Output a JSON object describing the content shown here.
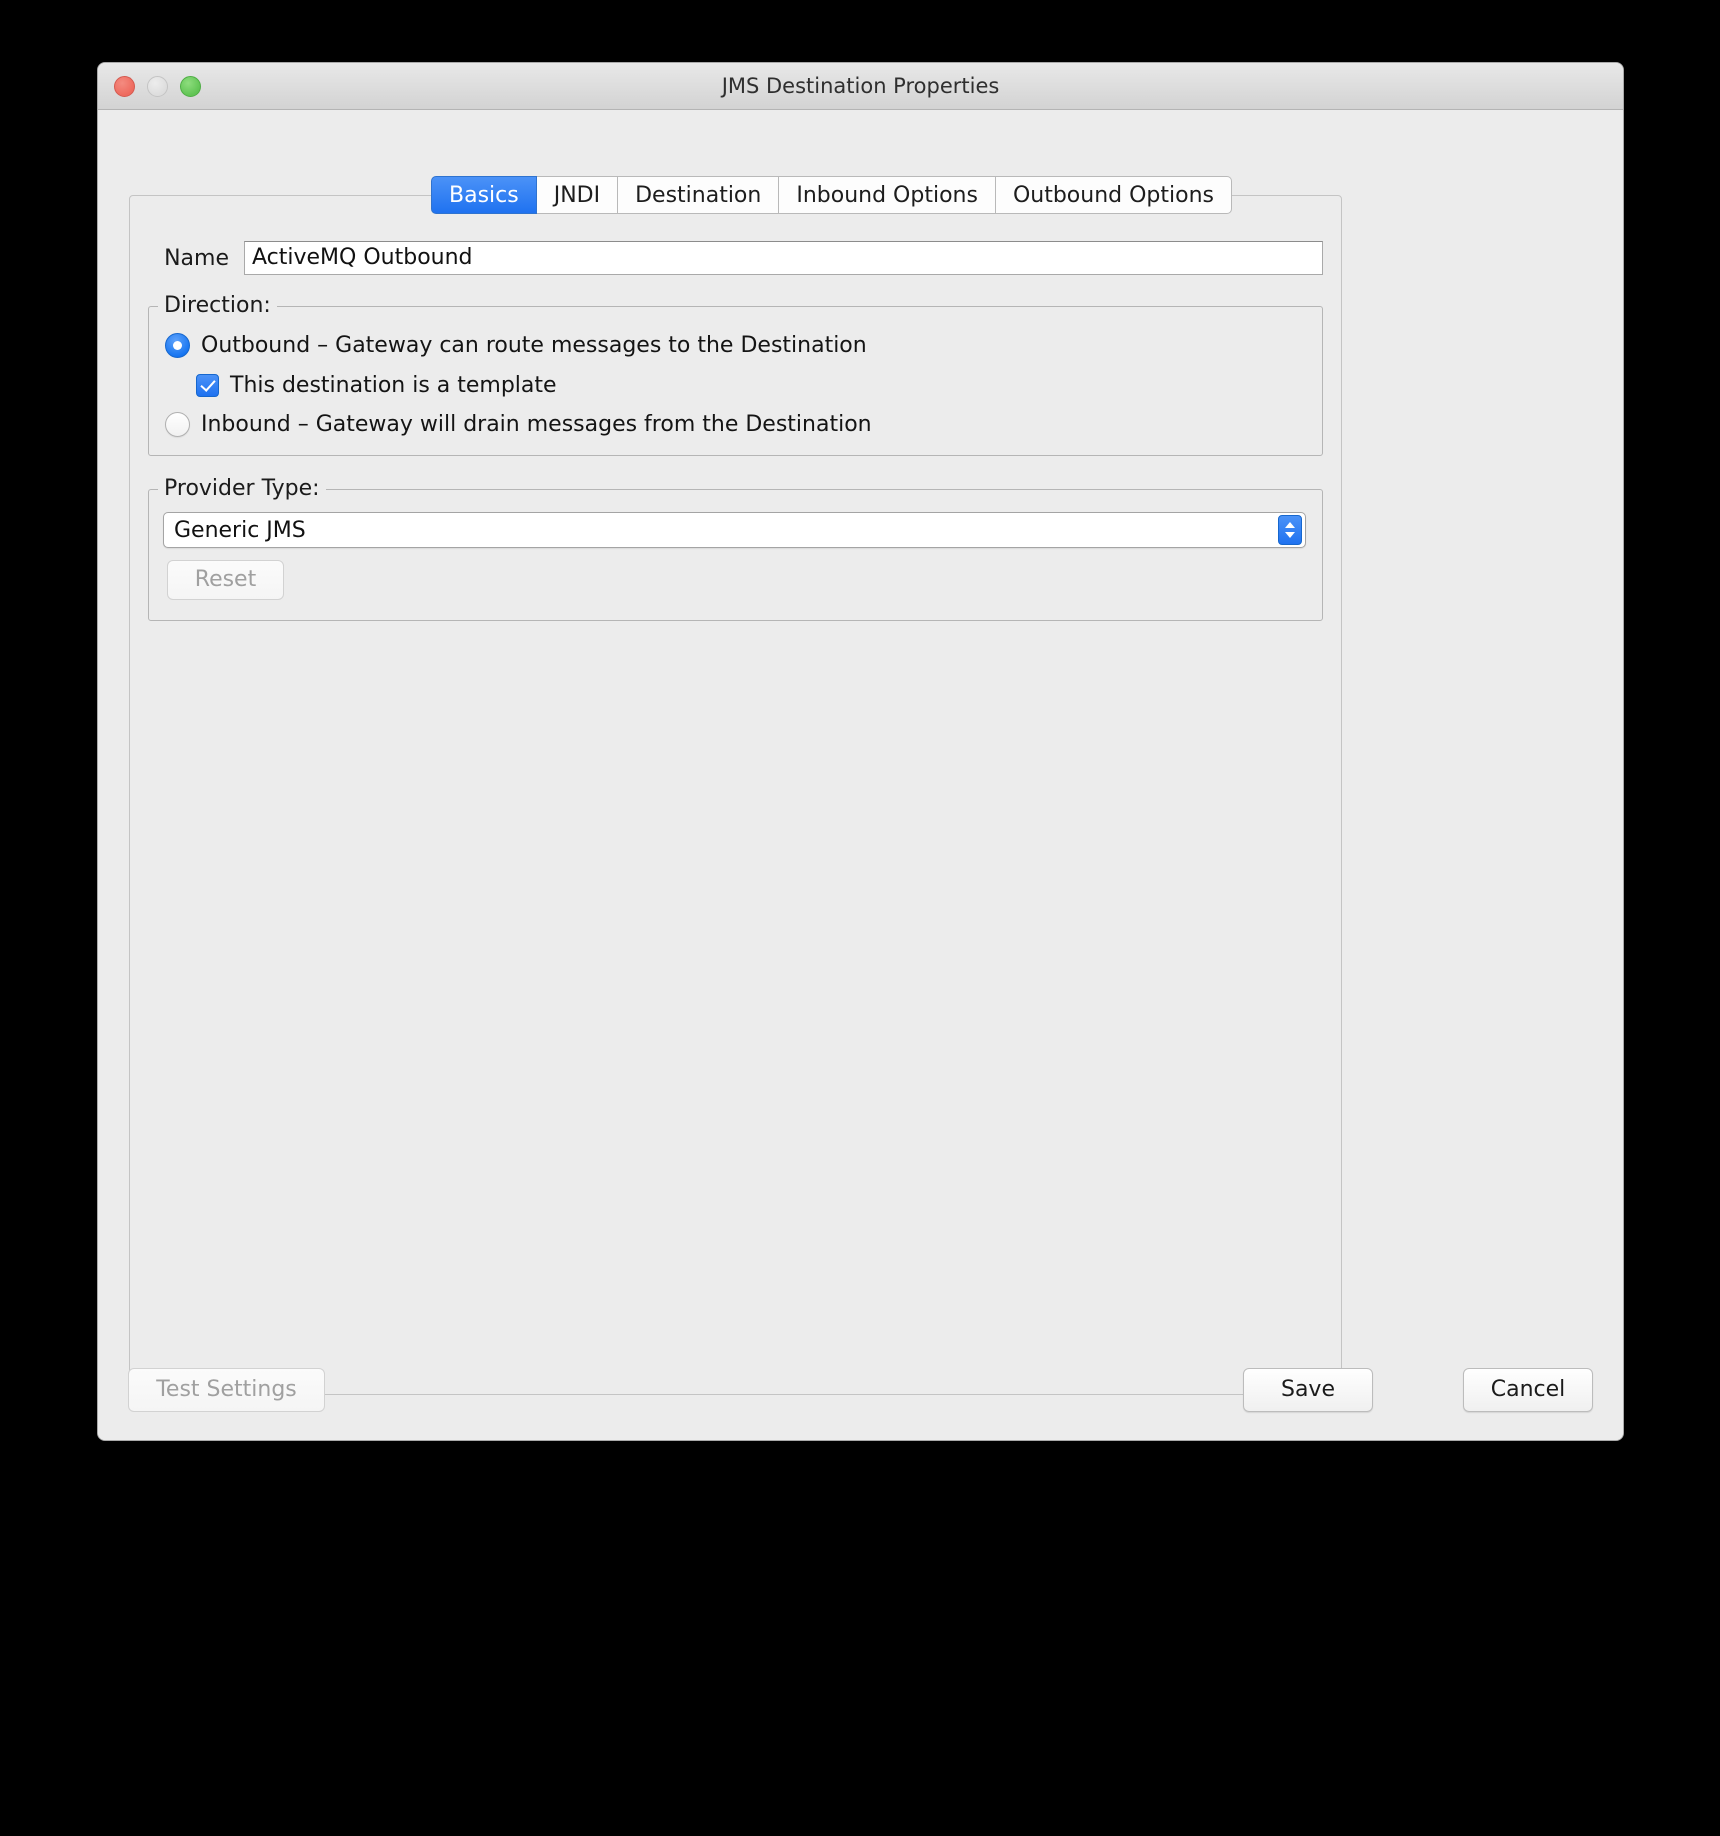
{
  "window": {
    "title": "JMS Destination Properties",
    "traffic_lights": [
      {
        "name": "close",
        "color": "#ee6a5e"
      },
      {
        "name": "minimize",
        "color": "#dddddd"
      },
      {
        "name": "zoom",
        "color": "#61c454"
      }
    ]
  },
  "tabs": [
    {
      "label": "Basics",
      "selected": true
    },
    {
      "label": "JNDI",
      "selected": false
    },
    {
      "label": "Destination",
      "selected": false
    },
    {
      "label": "Inbound Options",
      "selected": false
    },
    {
      "label": "Outbound Options",
      "selected": false
    }
  ],
  "form": {
    "name_label": "Name",
    "name_value": "ActiveMQ Outbound",
    "name_placeholder": "",
    "direction": {
      "legend": "Direction:",
      "outbound_label": "Outbound – Gateway can route messages to the Destination",
      "outbound_selected": true,
      "template_label": "This destination is a template",
      "template_checked": true,
      "inbound_label": "Inbound – Gateway will drain messages from the Destination",
      "inbound_selected": false
    },
    "provider": {
      "legend": "Provider Type:",
      "selected_value": "Generic JMS",
      "options": [
        "Generic JMS"
      ],
      "reset_label": "Reset",
      "reset_disabled": true
    }
  },
  "footer": {
    "test_settings_label": "Test Settings",
    "test_settings_disabled": true,
    "save_label": "Save",
    "cancel_label": "Cancel"
  },
  "colors": {
    "accent": "#1f72f0",
    "window_bg": "#ececec",
    "field_bg": "#ffffff",
    "text": "#141414",
    "disabled_text": "#a0a0a0"
  }
}
